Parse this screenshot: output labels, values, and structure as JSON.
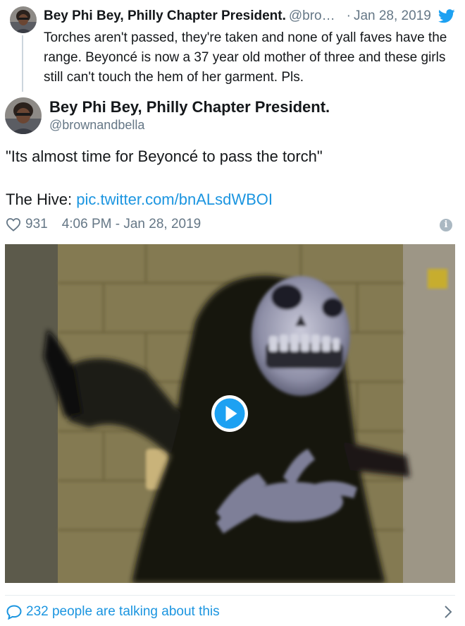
{
  "parent_tweet": {
    "name": "Bey Phi Bey, Philly Chapter President.",
    "handle": "@bro…",
    "separator": "·",
    "date": "Jan 28, 2019",
    "text": "Torches aren't passed, they're taken and none of yall faves have the range. Beyoncé is now a 37 year old mother of three and these girls still can't touch the hem of her garment. Pls.",
    "icon": "twitter-bird-icon"
  },
  "main_tweet": {
    "name": "Bey Phi Bey, Philly Chapter President.",
    "handle": "@brownandbella",
    "quote": "\"Its almost time for Beyoncé to pass the torch\"",
    "hive_prefix": "The Hive: ",
    "link": "pic.twitter.com/bnALsdWBOI",
    "likes": "931",
    "timestamp": "4:06 PM - Jan 28, 2019",
    "info_glyph": "i"
  },
  "media": {
    "type": "video",
    "description_icon": "play-button-icon"
  },
  "footer": {
    "talking_text": "232 people are talking about this"
  },
  "colors": {
    "link": "#1b95e0",
    "muted": "#657786",
    "text": "#14171a",
    "twitter_blue": "#1da1f2"
  }
}
